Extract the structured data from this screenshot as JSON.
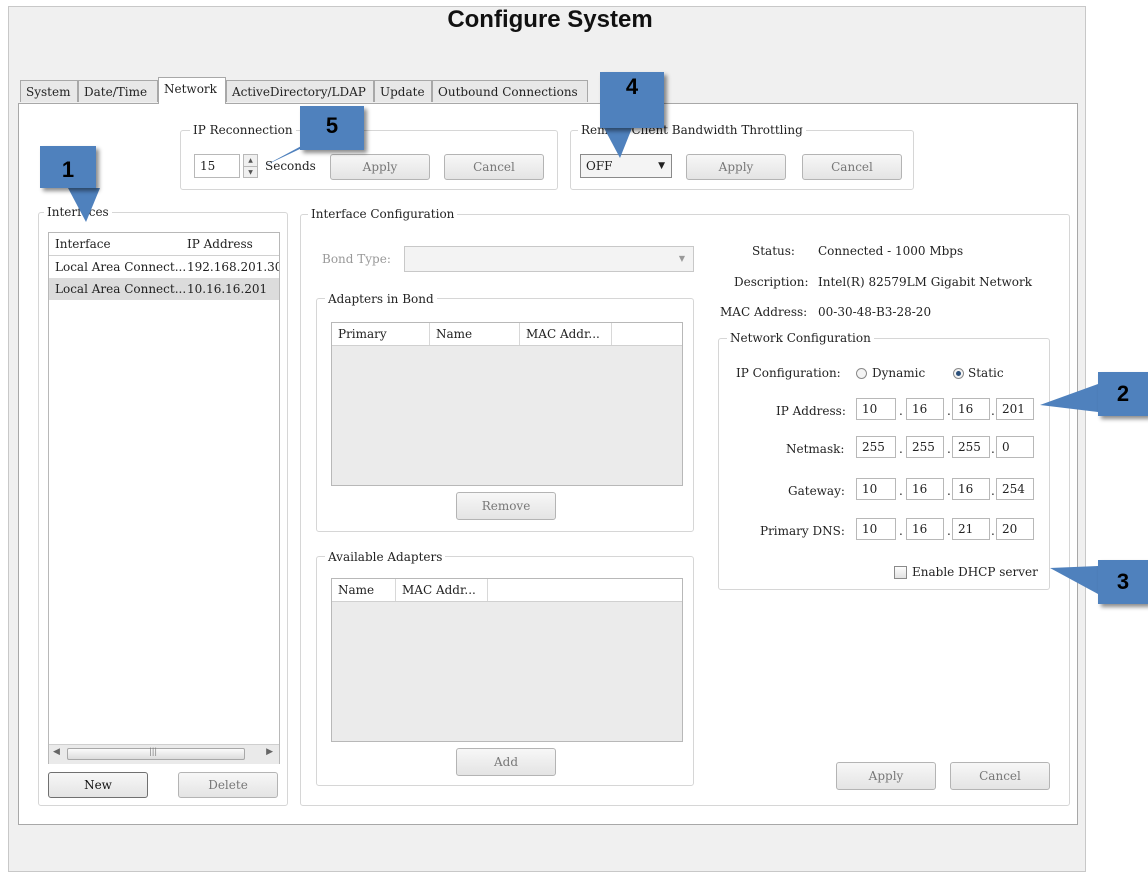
{
  "title": "Configure System",
  "tabs": [
    {
      "label": "System"
    },
    {
      "label": "Date/Time"
    },
    {
      "label": "Network"
    },
    {
      "label": "ActiveDirectory/LDAP"
    },
    {
      "label": "Update"
    },
    {
      "label": "Outbound Connections"
    }
  ],
  "ip_reconnection": {
    "label": "IP Reconnection",
    "value": "15",
    "unit": "Seconds",
    "apply": "Apply",
    "cancel": "Cancel"
  },
  "throttling": {
    "label": "Remote Client Bandwidth Throttling",
    "selected": "OFF",
    "apply": "Apply",
    "cancel": "Cancel"
  },
  "interfaces": {
    "label": "Interfaces",
    "columns": [
      "Interface",
      "IP Address"
    ],
    "rows": [
      {
        "name": "Local Area Connect...",
        "ip": "192.168.201.30"
      },
      {
        "name": "Local Area Connect...",
        "ip": "10.16.16.201"
      }
    ],
    "new": "New",
    "delete": "Delete"
  },
  "interface_config": {
    "label": "Interface Configuration",
    "bond_type_label": "Bond Type:",
    "adapters_in_bond": {
      "label": "Adapters in Bond",
      "columns": [
        "Primary",
        "Name",
        "MAC Addr..."
      ],
      "remove": "Remove"
    },
    "available_adapters": {
      "label": "Available Adapters",
      "columns": [
        "Name",
        "MAC Addr..."
      ],
      "add": "Add"
    },
    "status_label": "Status:",
    "status_value": "Connected - 1000 Mbps",
    "description_label": "Description:",
    "description_value": "Intel(R) 82579LM Gigabit Network",
    "mac_label": "MAC Address:",
    "mac_value": "00-30-48-B3-28-20",
    "apply": "Apply",
    "cancel": "Cancel"
  },
  "network_config": {
    "label": "Network Configuration",
    "ip_config_label": "IP Configuration:",
    "dynamic": "Dynamic",
    "static": "Static",
    "ip_address_label": "IP Address:",
    "ip_address": [
      "10",
      "16",
      "16",
      "201"
    ],
    "netmask_label": "Netmask:",
    "netmask": [
      "255",
      "255",
      "255",
      "0"
    ],
    "gateway_label": "Gateway:",
    "gateway": [
      "10",
      "16",
      "16",
      "254"
    ],
    "dns_label": "Primary DNS:",
    "dns": [
      "10",
      "16",
      "21",
      "20"
    ],
    "dhcp_label": "Enable DHCP server"
  },
  "callouts": [
    "1",
    "2",
    "3",
    "4",
    "5"
  ],
  "colors": {
    "callout": "#4f81bd"
  }
}
